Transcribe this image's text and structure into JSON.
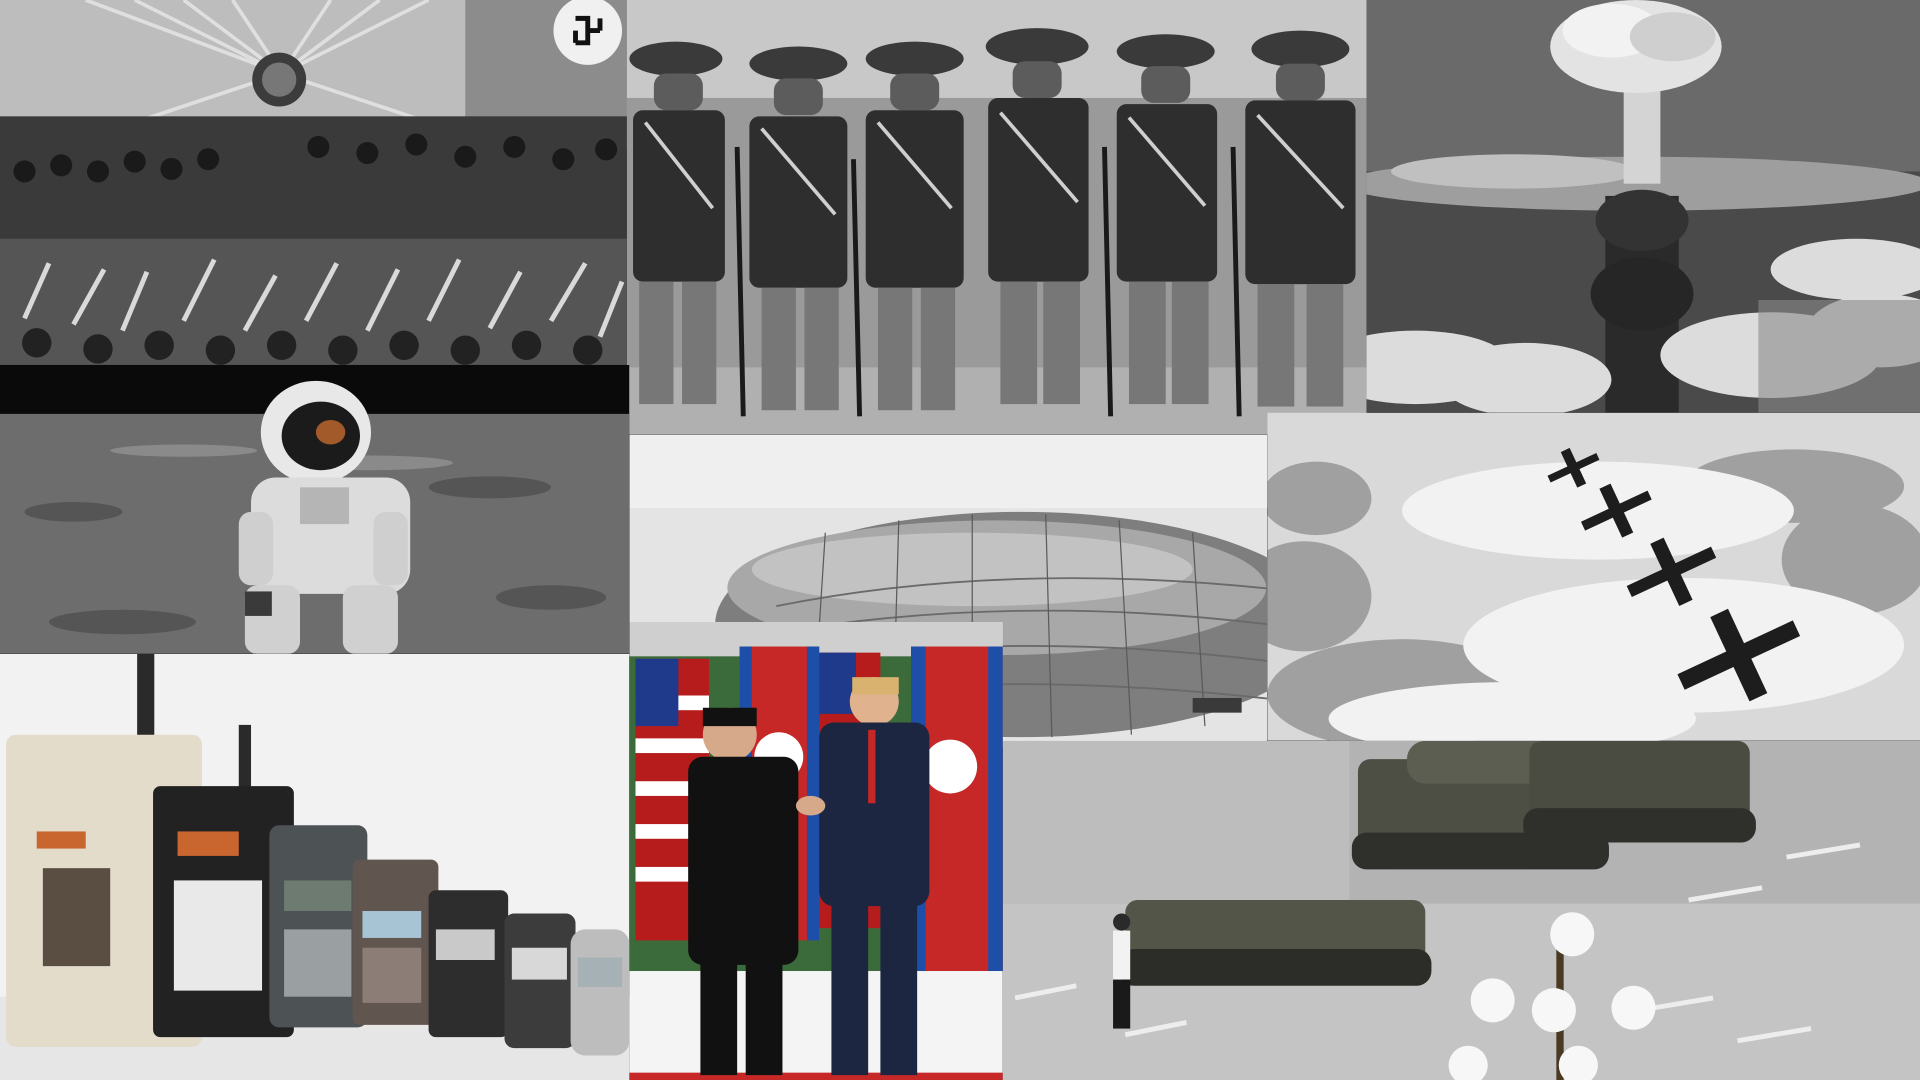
{
  "collage": {
    "panels": [
      {
        "name": "rally-panel",
        "depicts": "rally-hall"
      },
      {
        "name": "revolutionaries-panel",
        "depicts": "armed-group-portrait"
      },
      {
        "name": "mushroom-cloud-panel",
        "depicts": "mushroom-cloud"
      },
      {
        "name": "moon-landing-panel",
        "depicts": "astronaut-on-moon"
      },
      {
        "name": "airship-panel",
        "depicts": "zeppelin"
      },
      {
        "name": "bombers-panel",
        "depicts": "bomber-formation"
      },
      {
        "name": "mobile-phones-panel",
        "depicts": "phone-evolution"
      },
      {
        "name": "summit-handshake-panel",
        "depicts": "handshake-with-flags"
      },
      {
        "name": "crowd-panel",
        "depicts": "crowd-on-field"
      },
      {
        "name": "tank-man-panel",
        "depicts": "tanks-and-man"
      }
    ]
  }
}
